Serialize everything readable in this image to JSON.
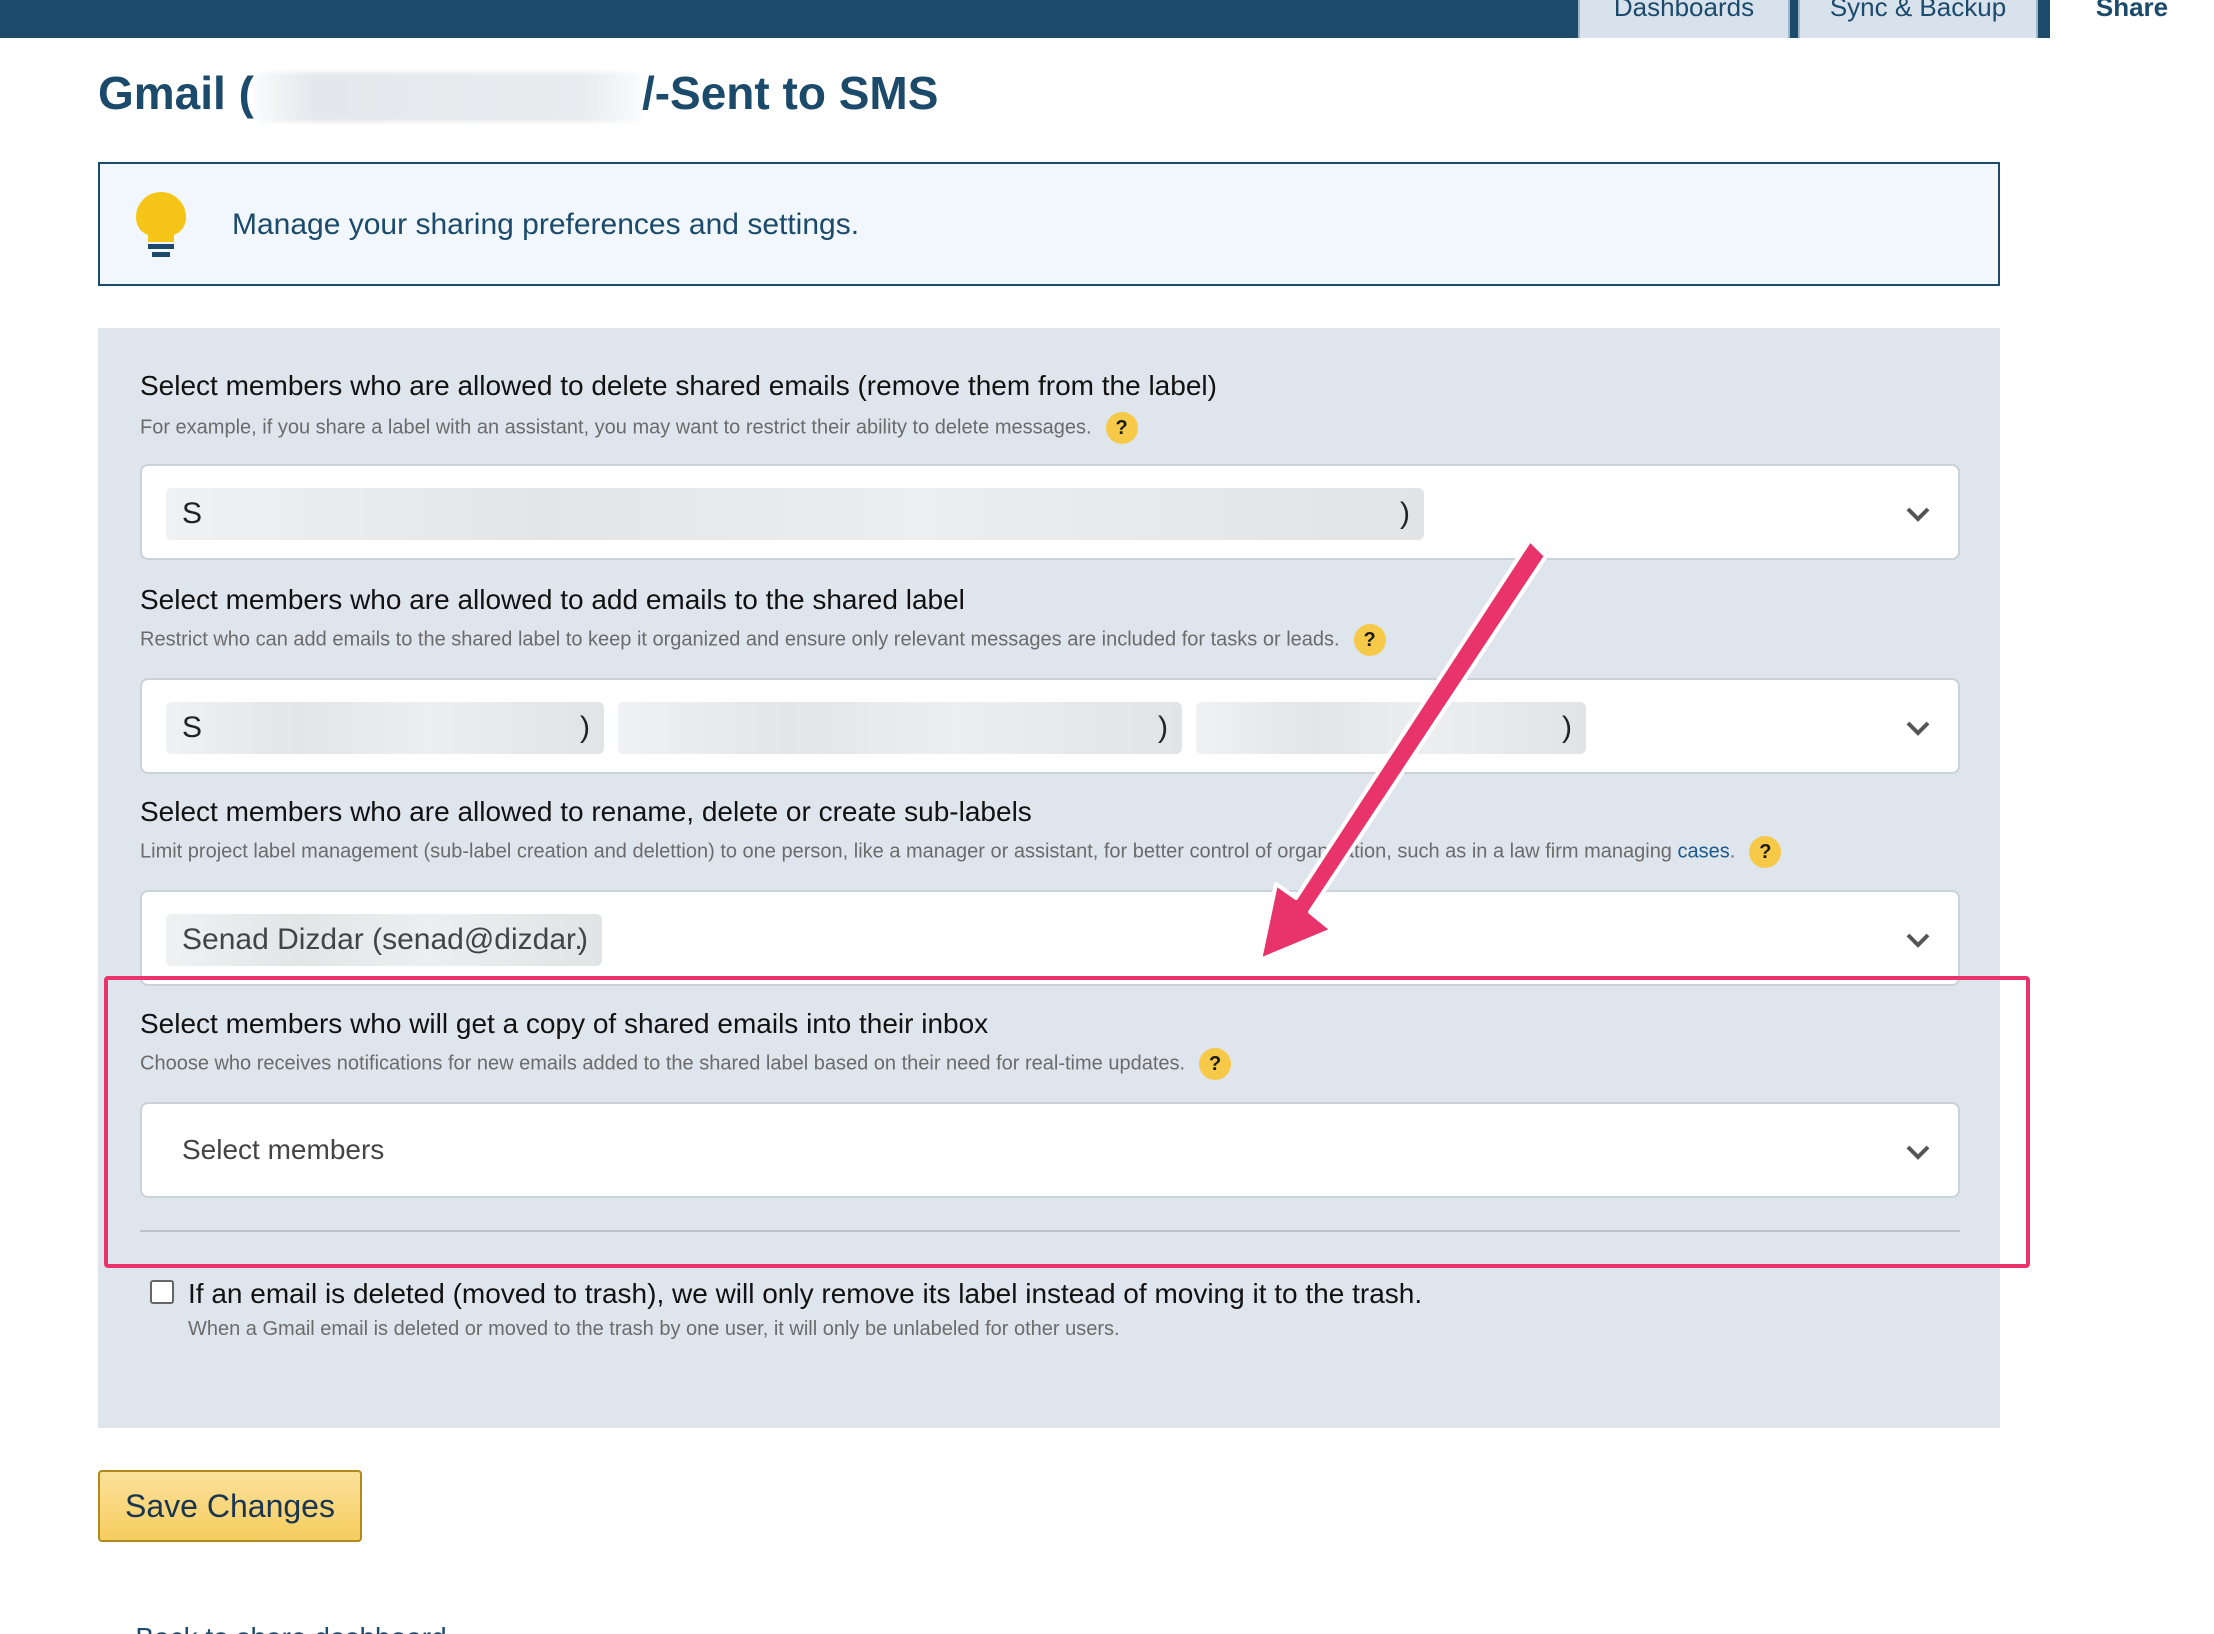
{
  "nav": {
    "tabs": [
      {
        "label": "Dashboards"
      },
      {
        "label": "Sync & Backup"
      },
      {
        "label": "Share"
      }
    ]
  },
  "page": {
    "title_prefix": "Gmail (",
    "title_suffix": "/-Sent to SMS"
  },
  "info": {
    "text": "Manage your sharing preferences and settings."
  },
  "sections": [
    {
      "title": "Select members who are allowed to delete shared emails (remove them from the label)",
      "description": "For example, if you share a label with an assistant, you may want to restrict their ability to delete messages.",
      "selected": [
        {
          "start": "S",
          "end": ")"
        }
      ]
    },
    {
      "title": "Select members who are allowed to add emails to the shared label",
      "description": "Restrict who can add emails to the shared label to keep it organized and ensure only relevant messages are included for tasks or leads.",
      "selected": [
        {
          "start": "S",
          "end": ")"
        },
        {
          "start": "",
          "end": ")"
        },
        {
          "start": "",
          "end": ")"
        }
      ]
    },
    {
      "title": "Select members who are allowed to rename, delete or create sub-labels",
      "description": "Limit project label management (sub-label creation and delettion) to one person, like a manager or assistant, for better control of organization, such as in a law firm managing",
      "link": "cases",
      "link_suffix": ".",
      "selected": [
        {
          "start": "Senad Dizdar (senad@dizdar.",
          "end": ")"
        }
      ]
    },
    {
      "title": "Select members who will get a copy of shared emails into their inbox",
      "description": "Choose who receives notifications for new emails added to the shared label based on their need for real-time updates.",
      "placeholder": "Select members"
    }
  ],
  "help_icon": "?",
  "trash_option": {
    "checked": false,
    "label": "If an email is deleted (moved to trash), we will only remove its label instead of moving it to the trash.",
    "description": "When a Gmail email is deleted or moved to the trash by one user, it will only be unlabeled for other users."
  },
  "save_button": "Save Changes",
  "back_link": "« Back to share dashboard",
  "colors": {
    "nav": "#1b4a6b",
    "panel": "#dfe5ec",
    "help": "#f7c948",
    "annotation": "#e8336b"
  }
}
